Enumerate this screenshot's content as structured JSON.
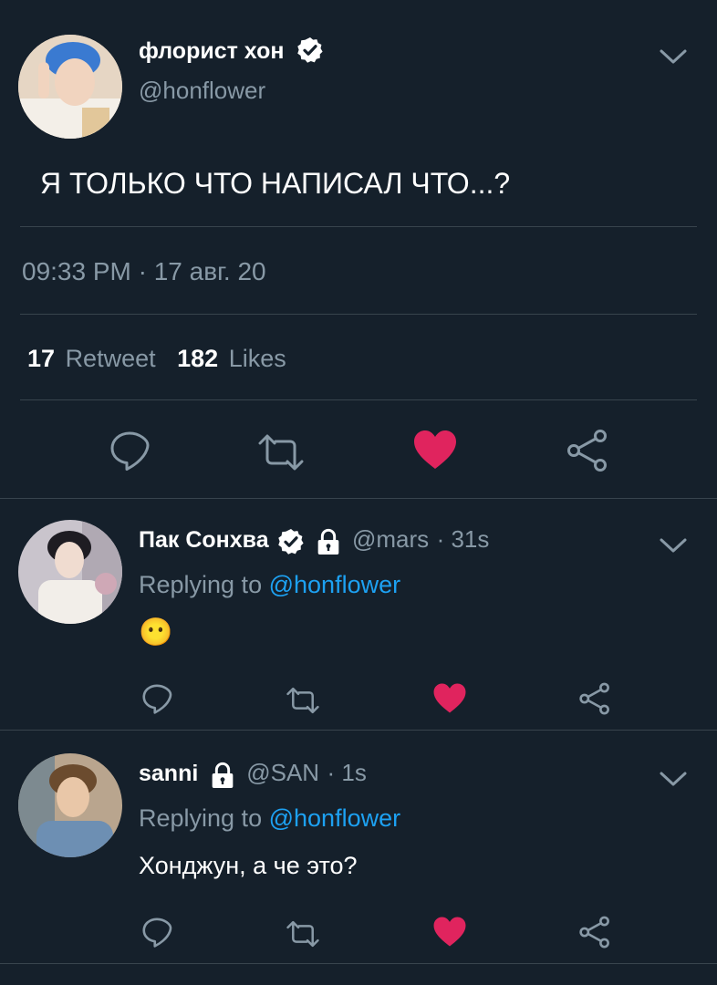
{
  "main_tweet": {
    "display_name": "флорист хон",
    "handle": "@honflower",
    "text": "Я ТОЛЬКО ЧТО НАПИСАЛ ЧТО...?",
    "timestamp": "09:33 PM · 17 авг. 20",
    "retweet_count": "17",
    "retweet_label": "Retweet",
    "like_count": "182",
    "like_label": "Likes"
  },
  "replies": [
    {
      "display_name": "Пак Сонхва",
      "handle": "@mars",
      "time": "· 31s",
      "replying_prefix": "Replying to",
      "replying_to": "@honflower",
      "text": "😶"
    },
    {
      "display_name": "sanni",
      "handle": "@SAN",
      "time": "· 1s",
      "replying_prefix": "Replying to",
      "replying_to": "@honflower",
      "text": "Хонджун, а че это?"
    }
  ],
  "colors": {
    "background": "#15202b",
    "muted": "#8899a6",
    "link": "#1da1f2",
    "like": "#e0245e",
    "divider": "#38444d"
  }
}
